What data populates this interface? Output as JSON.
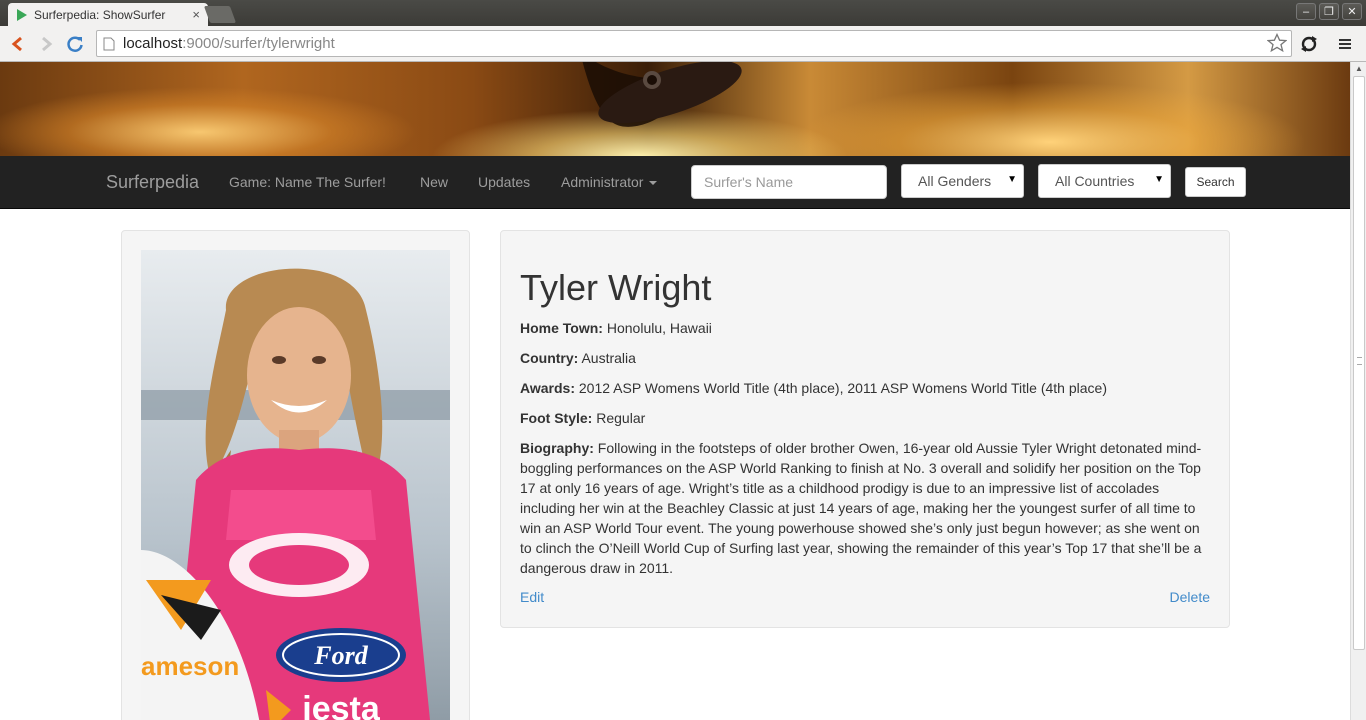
{
  "browser": {
    "tab_title": "Surferpedia: ShowSurfer",
    "tab_close": "×",
    "url_host": "localhost",
    "url_path": ":9000/surfer/tylerwright",
    "window_buttons": [
      "–",
      "❐",
      "✕"
    ]
  },
  "navbar": {
    "brand": "Surferpedia",
    "links": [
      "Game: Name The Surfer!",
      "New",
      "Updates",
      "Administrator"
    ],
    "search_placeholder": "Surfer's Name",
    "gender_select": "All Genders",
    "country_select": "All Countries",
    "search_button": "Search"
  },
  "surfer": {
    "name": "Tyler Wright",
    "hometown_label": "Home Town:",
    "hometown": "Honolulu, Hawaii",
    "country_label": "Country:",
    "country": "Australia",
    "awards_label": "Awards:",
    "awards": "2012 ASP Womens World Title (4th place), 2011 ASP Womens World Title (4th place)",
    "footstyle_label": "Foot Style:",
    "footstyle": "Regular",
    "bio_label": "Biography:",
    "bio": "Following in the footsteps of older brother Owen, 16-year old Aussie Tyler Wright detonated mind-boggling performances on the ASP World Ranking to finish at No. 3 overall and solidify her position on the Top 17 at only 16 years of age. Wright’s title as a childhood prodigy is due to an impressive list of accolades including her win at the Beachley Classic at just 14 years of age, making her the youngest surfer of all time to win an ASP World Tour event. The young powerhouse showed she’s only just begun however; as she went on to clinch the O’Neill World Cup of Surfing last year, showing the remainder of this year’s Top 17 that she’ll be a dangerous draw in 2011."
  },
  "actions": {
    "edit": "Edit",
    "delete": "Delete"
  },
  "photo_text": {
    "board_brand": "ameson",
    "shirt_brand": "Ford",
    "shirt_model": "iesta"
  },
  "colors": {
    "navbar_bg": "#222222",
    "link": "#428bca",
    "well_bg": "#f5f5f5"
  }
}
